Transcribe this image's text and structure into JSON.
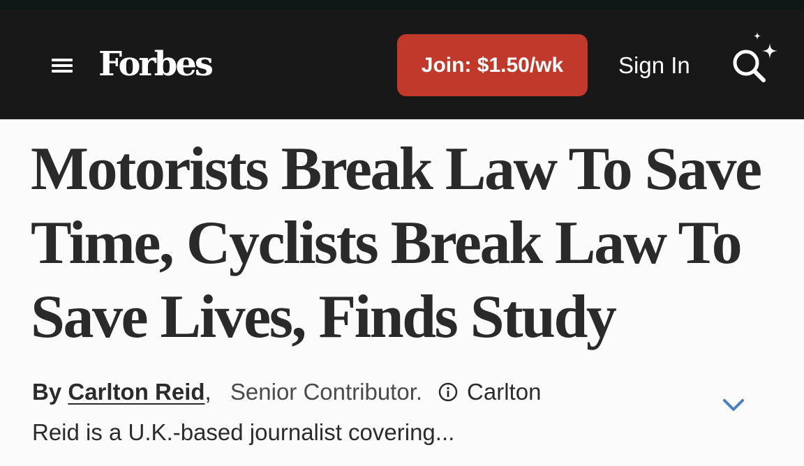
{
  "header": {
    "logo": "Forbes",
    "join_label": "Join: $1.50/wk",
    "signin_label": "Sign In",
    "menu_icon": "hamburger-menu-icon",
    "search_icon": "ai-search-icon",
    "background_color": "#181818",
    "join_color": "#c0392b"
  },
  "article": {
    "headline_lines": [
      "Motorists Break Law To Save",
      "Time, Cyclists Break Law To",
      "Save Lives, Finds Study"
    ],
    "byline": {
      "by": "By",
      "author": "Carlton Reid",
      "comma": ",",
      "role": "Senior Contributor.",
      "info_icon": "info-circle-icon",
      "bio_start": "Carlton",
      "bio_rest": "Reid is a U.K.-based journalist covering...",
      "expand_icon": "chevron-down-icon",
      "expand_color": "#4a7fc1"
    }
  }
}
